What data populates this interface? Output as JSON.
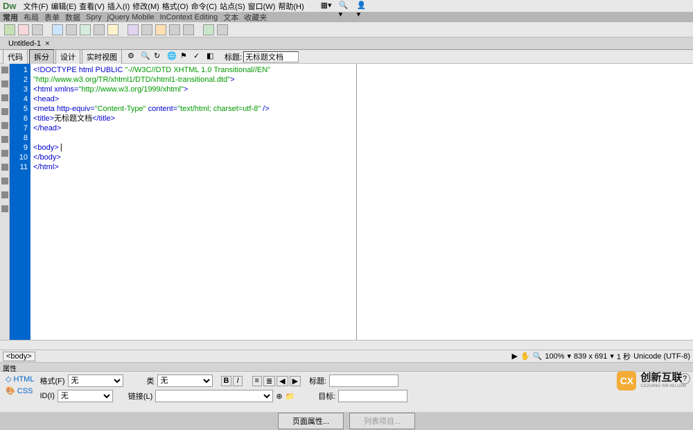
{
  "app": {
    "logo": "Dw"
  },
  "menu": [
    "文件(F)",
    "编辑(E)",
    "查看(V)",
    "插入(I)",
    "修改(M)",
    "格式(O)",
    "命令(C)",
    "站点(S)",
    "窗口(W)",
    "帮助(H)"
  ],
  "tabbar": [
    "常用",
    "布局",
    "表单",
    "数据",
    "Spry",
    "jQuery Mobile",
    "InContext Editing",
    "文本",
    "收藏夹"
  ],
  "doctab": {
    "name": "Untitled-1",
    "close": "×"
  },
  "viewbar": {
    "buttons": [
      "代码",
      "拆分",
      "设计",
      "实时视图"
    ],
    "title_label": "标题:",
    "title_value": "无标题文档"
  },
  "code": {
    "lines": [
      1,
      2,
      3,
      4,
      5,
      6,
      7,
      8,
      9,
      10,
      11
    ],
    "l1a": "<!DOCTYPE html PUBLIC ",
    "l1b": "\"-//W3C//DTD XHTML 1.0 Transitional//EN\"",
    "l1c": "\"http://www.w3.org/TR/xhtml1/DTD/xhtml1-transitional.dtd\"",
    "l1d": ">",
    "l2a": "<html xmlns=",
    "l2b": "\"http://www.w3.org/1999/xhtml\"",
    "l2c": ">",
    "l3": "<head>",
    "l4a": "<meta http-equiv=",
    "l4b": "\"Content-Type\"",
    "l4c": " content=",
    "l4d": "\"text/html; charset=utf-8\"",
    "l4e": " />",
    "l5a": "<title>",
    "l5b": "无标题文档",
    "l5c": "</title>",
    "l6": "</head>",
    "l7": "",
    "l8": "<body>",
    "l9": "</body>",
    "l10": "</html>",
    "l11": ""
  },
  "breadcrumb": {
    "path": "<body>"
  },
  "status": {
    "zoom": "100%",
    "dimensions": "839 x 691",
    "timing": "1 秒",
    "encoding": "Unicode (UTF-8)"
  },
  "props": {
    "header": "属性",
    "html_tab": "HTML",
    "css_tab": "CSS",
    "format_label": "格式(F)",
    "format_value": "无",
    "id_label": "ID(I)",
    "id_value": "无",
    "class_label": "类",
    "class_value": "无",
    "link_label": "链接(L)",
    "link_value": "",
    "title2_label": "标题:",
    "target_label": "目标:"
  },
  "footer": {
    "page_props": "页面属性...",
    "list_item": "列表项目..."
  },
  "watermark": {
    "main": "创新互联",
    "sub": "CXJUANG XIN HU LIAN"
  }
}
